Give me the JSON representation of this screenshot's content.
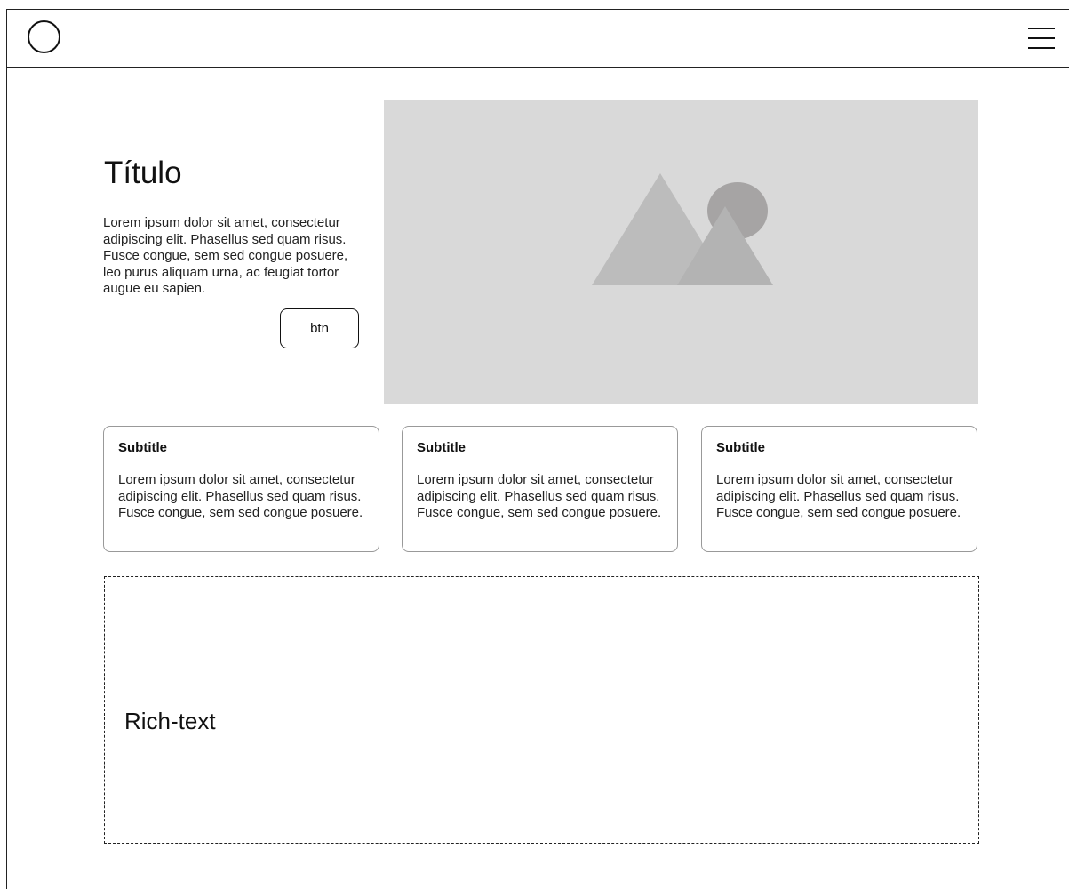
{
  "navbar": {
    "logo_icon": "circle-logo-icon",
    "menu_icon": "hamburger-menu-icon"
  },
  "hero": {
    "title": "Título",
    "text": "Lorem ipsum dolor sit amet, consectetur adipiscing elit. Phasellus sed quam risus. Fusce congue, sem sed congue posuere, leo purus aliquam urna, ac feugiat tortor augue eu sapien.",
    "button_label": "btn",
    "image_icon": "image-placeholder-icon"
  },
  "cards": [
    {
      "title": "Subtitle",
      "text": "Lorem ipsum dolor sit amet, consectetur adipiscing elit. Phasellus sed quam risus. Fusce congue, sem sed congue posuere."
    },
    {
      "title": "Subtitle",
      "text": "Lorem ipsum dolor sit amet, consectetur adipiscing elit. Phasellus sed quam risus. Fusce congue, sem sed congue posuere."
    },
    {
      "title": "Subtitle",
      "text": "Lorem ipsum dolor sit amet, consectetur adipiscing elit. Phasellus sed quam risus. Fusce congue, sem sed congue posuere."
    }
  ],
  "rich_text": {
    "label": "Rich-text"
  },
  "colors": {
    "image_bg": "#d9d9d9",
    "image_shape_light": "#bcbcbc",
    "image_shape_dark": "#a6a4a4",
    "card_border": "#999999",
    "text": "#111111"
  }
}
